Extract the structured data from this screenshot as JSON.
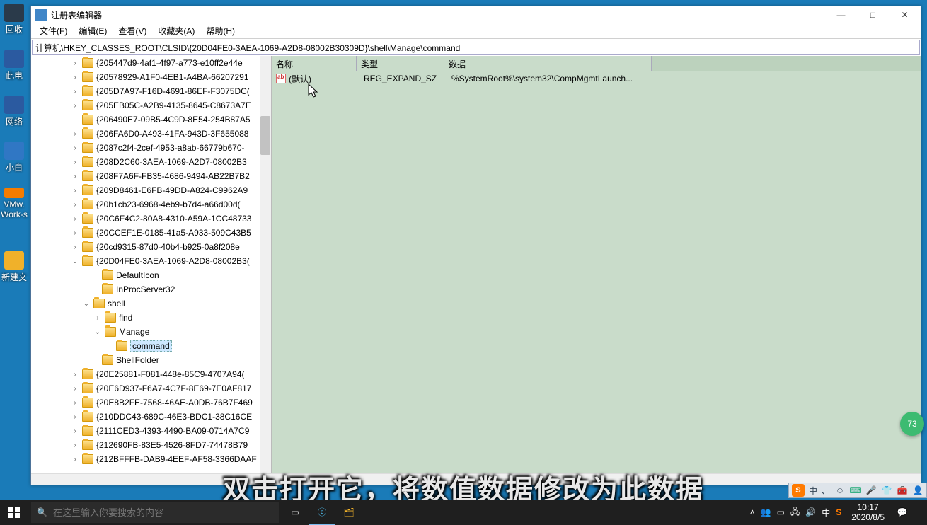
{
  "window": {
    "title": "注册表编辑器",
    "menu": {
      "file": "文件(F)",
      "edit": "编辑(E)",
      "view": "查看(V)",
      "favorites": "收藏夹(A)",
      "help": "帮助(H)"
    },
    "address_path": "计算机\\HKEY_CLASSES_ROOT\\CLSID\\{20D04FE0-3AEA-1069-A2D8-08002B30309D}\\shell\\Manage\\command"
  },
  "tree": {
    "nodes": [
      "{205447d9-4af1-4f97-a773-e10ff2e44e",
      "{20578929-A1F0-4EB1-A4BA-66207291",
      "{205D7A97-F16D-4691-86EF-F3075DC(",
      "{205EB05C-A2B9-4135-8645-C8673A7E",
      "{206490E7-09B5-4C9D-8E54-254B87A5",
      "{206FA6D0-A493-41FA-943D-3F655088",
      "{2087c2f4-2cef-4953-a8ab-66779b670-",
      "{208D2C60-3AEA-1069-A2D7-08002B3",
      "{208F7A6F-FB35-4686-9494-AB22B7B2",
      "{209D8461-E6FB-49DD-A824-C9962A9",
      "{20b1cb23-6968-4eb9-b7d4-a66d00d(",
      "{20C6F4C2-80A8-4310-A59A-1CC48733",
      "{20CCEF1E-0185-41a5-A933-509C43B5",
      "{20cd9315-87d0-40b4-b925-0a8f208e"
    ],
    "selected_parent": "{20D04FE0-3AEA-1069-A2D8-08002B3(",
    "children": {
      "defaulticon": "DefaultIcon",
      "inprocserver": "InProcServer32",
      "shell": "shell",
      "find": "find",
      "manage": "Manage",
      "command": "command",
      "shellfolder": "ShellFolder"
    },
    "after": [
      "{20E25881-F081-448e-85C9-4707A94(",
      "{20E6D937-F6A7-4C7F-8E69-7E0AF817",
      "{20E8B2FE-7568-46AE-A0DB-76B7F469",
      "{210DDC43-689C-46E3-BDC1-38C16CE",
      "{2111CED3-4393-4490-BA09-0714A7C9",
      "{212690FB-83E5-4526-8FD7-74478B79",
      "{212BFFFB-DAB9-4EEF-AF58-3366DAAF"
    ]
  },
  "values": {
    "headers": {
      "name": "名称",
      "type": "类型",
      "data": "数据"
    },
    "row": {
      "name": "(默认)",
      "type": "REG_EXPAND_SZ",
      "data": "%SystemRoot%\\system32\\CompMgmtLaunch..."
    }
  },
  "desktop": {
    "i1": "回收",
    "i2": "此电",
    "i3": "网络",
    "i4": "小白",
    "i5": "VMw.\nWork-s",
    "i6": "新建文"
  },
  "subtitle": "双击打开它，将数值数据修改为此数据",
  "ime": {
    "zhong": "中",
    "dot": "、"
  },
  "taskbar": {
    "search_placeholder": "在这里输入你要搜索的内容",
    "ime_lang": "中",
    "time": "10:17",
    "date": "2020/8/5"
  },
  "float_badge": "73"
}
